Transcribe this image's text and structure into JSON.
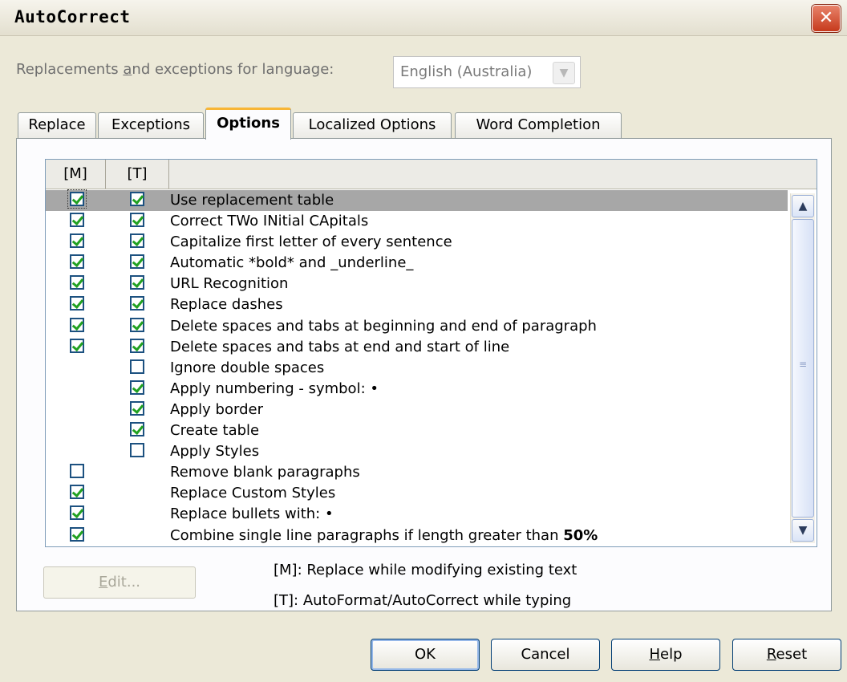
{
  "window": {
    "title": "AutoCorrect",
    "close_glyph": "✕"
  },
  "language": {
    "label_pre": "Replacements ",
    "label_u": "a",
    "label_post": "nd exceptions for language:",
    "value": "English (Australia)"
  },
  "tabs": [
    "Replace",
    "Exceptions",
    "Options",
    "Localized Options",
    "Word Completion"
  ],
  "active_tab": "Options",
  "list": {
    "headers": {
      "m": "[M]",
      "t": "[T]"
    },
    "options": [
      {
        "label": "Use replacement table",
        "m": true,
        "t": true,
        "selected": true
      },
      {
        "label": "Correct TWo INitial CApitals",
        "m": true,
        "t": true
      },
      {
        "label": "Capitalize first letter of every sentence",
        "m": true,
        "t": true
      },
      {
        "label": "Automatic *bold* and _underline_",
        "m": true,
        "t": true
      },
      {
        "label": "URL Recognition",
        "m": true,
        "t": true
      },
      {
        "label": "Replace dashes",
        "m": true,
        "t": true
      },
      {
        "label": "Delete spaces and tabs at beginning and end of paragraph",
        "m": true,
        "t": true
      },
      {
        "label": "Delete spaces and tabs at end and start of line",
        "m": true,
        "t": true
      },
      {
        "label": "Ignore double spaces",
        "m": null,
        "t": false
      },
      {
        "label": "Apply numbering - symbol: •",
        "m": null,
        "t": true
      },
      {
        "label": "Apply border",
        "m": null,
        "t": true
      },
      {
        "label": "Create table",
        "m": null,
        "t": true
      },
      {
        "label": "Apply Styles",
        "m": null,
        "t": false
      },
      {
        "label": "Remove blank paragraphs",
        "m": false,
        "t": null
      },
      {
        "label": "Replace Custom Styles",
        "m": true,
        "t": null
      },
      {
        "label": "Replace bullets with: •",
        "m": true,
        "t": null
      },
      {
        "label": "Combine single line paragraphs if length greater than ",
        "bold_suffix": "50%",
        "m": true,
        "t": null
      }
    ]
  },
  "edit_button": {
    "u": "E",
    "rest": "dit..."
  },
  "legend": {
    "m": "[M]: Replace while modifying existing text",
    "t": "[T]: AutoFormat/AutoCorrect while typing"
  },
  "buttons": {
    "ok": "OK",
    "cancel": "Cancel",
    "help": {
      "u": "H",
      "rest": "elp"
    },
    "reset": {
      "u": "R",
      "rest": "eset"
    }
  },
  "icons": {
    "scroll_up": "▲",
    "scroll_down": "▼",
    "dropdown": "▼"
  }
}
